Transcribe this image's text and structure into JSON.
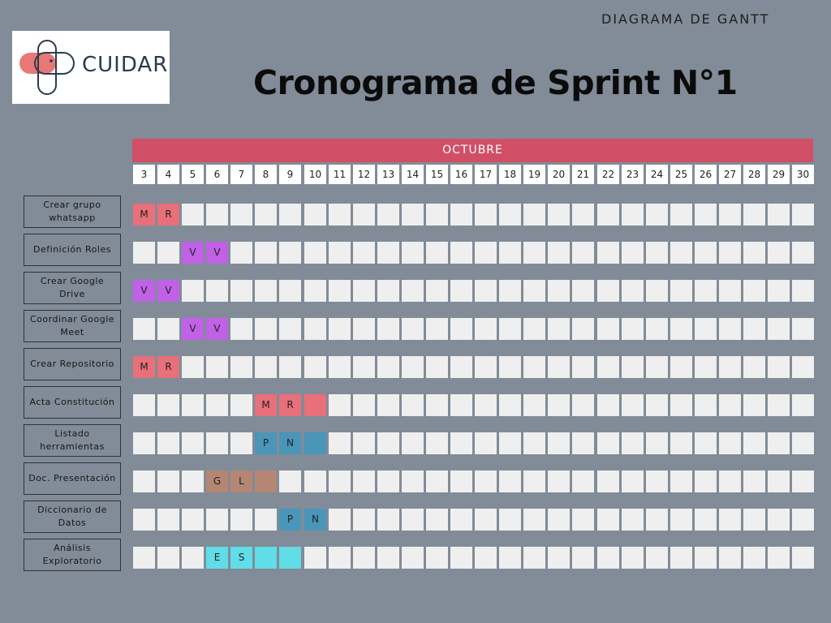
{
  "header": {
    "top_label": "DIAGRAMA DE GANTT",
    "title": "Cronograma de Sprint N°1",
    "logo_text": "CUIDAR"
  },
  "gantt": {
    "month": "OCTUBRE",
    "days": [
      "3",
      "4",
      "5",
      "6",
      "7",
      "8",
      "9",
      "10",
      "11",
      "12",
      "13",
      "14",
      "15",
      "16",
      "17",
      "18",
      "19",
      "20",
      "21",
      "22",
      "23",
      "24",
      "25",
      "26",
      "27",
      "28",
      "29",
      "30"
    ],
    "tasks": [
      {
        "label": "Crear grupo whatsapp",
        "color": "#e8707a",
        "start": 0,
        "length": 2,
        "letters": [
          "M",
          "R"
        ]
      },
      {
        "label": "Definición Roles",
        "color": "#c061e6",
        "start": 2,
        "length": 2,
        "letters": [
          "V",
          "V"
        ]
      },
      {
        "label": "Crear Google Drive",
        "color": "#c061e6",
        "start": 0,
        "length": 2,
        "letters": [
          "V",
          "V"
        ]
      },
      {
        "label": "Coordinar Google Meet",
        "color": "#c061e6",
        "start": 2,
        "length": 2,
        "letters": [
          "V",
          "V"
        ]
      },
      {
        "label": "Crear Repositorio",
        "color": "#e8707a",
        "start": 0,
        "length": 2,
        "letters": [
          "M",
          "R"
        ]
      },
      {
        "label": "Acta Constitución",
        "color": "#e8707a",
        "start": 5,
        "length": 3,
        "letters": [
          "M",
          "R",
          ""
        ]
      },
      {
        "label": "Listado herramientas",
        "color": "#4a96b8",
        "start": 5,
        "length": 3,
        "letters": [
          "P",
          "N",
          ""
        ]
      },
      {
        "label": "Doc. Presentación",
        "color": "#b58674",
        "start": 3,
        "length": 3,
        "letters": [
          "G",
          "L",
          ""
        ]
      },
      {
        "label": "Diccionario de Datos",
        "color": "#4a96b8",
        "start": 6,
        "length": 2,
        "letters": [
          "P",
          "N"
        ]
      },
      {
        "label": "Análisis Exploratorio",
        "color": "#60dde7",
        "start": 3,
        "length": 4,
        "letters": [
          "E",
          "S",
          "",
          ""
        ]
      }
    ],
    "empty_cell_color": "#efefef"
  }
}
